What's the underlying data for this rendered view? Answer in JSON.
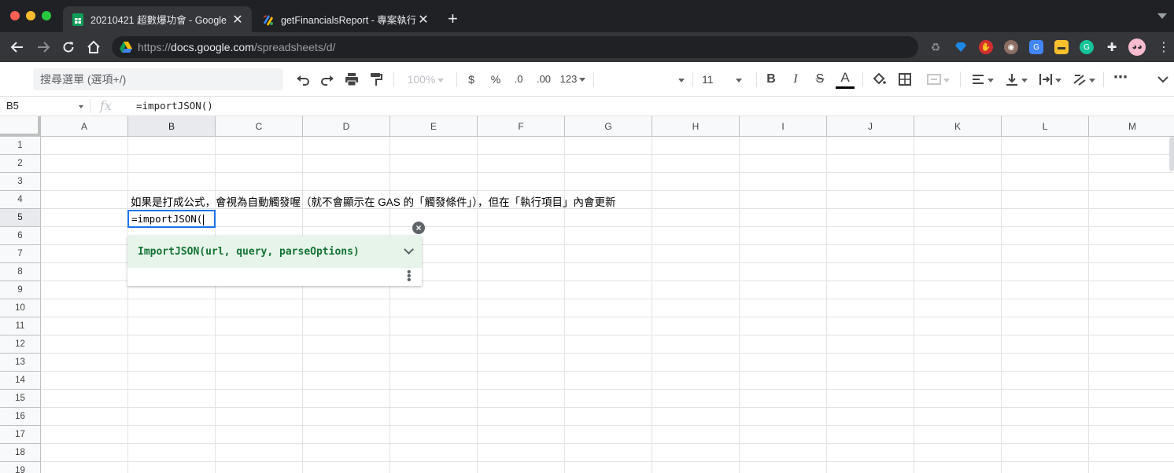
{
  "browser": {
    "tabs": [
      {
        "title": "20210421 超數爆功會 - Google",
        "active": true,
        "favicon": "google-sheets-icon"
      },
      {
        "title": "getFinancialsReport - 專案執行",
        "active": false,
        "favicon": "apps-script-icon"
      }
    ],
    "new_tab_label": "+",
    "close_glyph": "✕",
    "url_prefix": "https://",
    "url_host": "docs.google.com",
    "url_path": "/spreadsheets/d/"
  },
  "toolbar": {
    "menu_search_placeholder": "搜尋選單 (選項+/)",
    "zoom": "100%",
    "currency": "$",
    "percent": "%",
    "decrease_decimal": ".0",
    "increase_decimal": ".00",
    "more_formats": "123",
    "font_family": "",
    "font_size": "11",
    "bold": "B",
    "italic": "I",
    "strikethrough": "S",
    "text_color": "A",
    "more": "⋯"
  },
  "formula_bar": {
    "name_box": "B5",
    "fx_label": "fx",
    "formula": "=importJSON()"
  },
  "grid": {
    "columns": [
      "A",
      "B",
      "C",
      "D",
      "E",
      "F",
      "G",
      "H",
      "I",
      "J",
      "K",
      "L",
      "M"
    ],
    "selected_column": "B",
    "rows": [
      "1",
      "2",
      "3",
      "4",
      "5",
      "6",
      "7",
      "8",
      "9",
      "10",
      "11",
      "12",
      "13",
      "14",
      "15",
      "16",
      "17",
      "18",
      "19"
    ],
    "selected_row": "5",
    "cell_B4": "如果是打成公式，會視為自動觸發喔（就不會顯示在 GAS 的「觸發條件」），但在「執行項目」內會更新",
    "cell_B5_editing": "=importJSON("
  },
  "autocomplete": {
    "signature": "ImportJSON(url, query, parseOptions)",
    "close_glyph": "×",
    "more_glyph": "⋮"
  },
  "colors": {
    "accent": "#1a73e8",
    "suggest_bg": "#e6f4ea",
    "suggest_text": "#137333"
  }
}
